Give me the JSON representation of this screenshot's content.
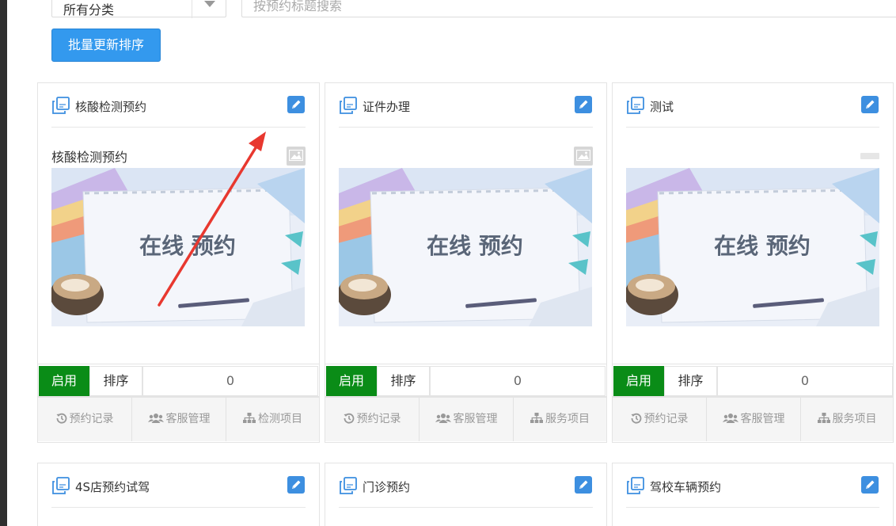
{
  "filters": {
    "category_value": "所有分类",
    "search_placeholder": "按预约标题搜索"
  },
  "toolbar": {
    "batch_sort_label": "批量更新排序"
  },
  "banner_text": "在线 预约",
  "labels": {
    "enable": "启用",
    "sort": "排序"
  },
  "cards": [
    {
      "title": "核酸检测预约",
      "subtitle": "核酸检测预约",
      "sort_value": "0",
      "actions": [
        "预约记录",
        "客服管理",
        "检测项目"
      ]
    },
    {
      "title": "证件办理",
      "subtitle": "",
      "sort_value": "0",
      "actions": [
        "预约记录",
        "客服管理",
        "服务项目"
      ]
    },
    {
      "title": "测试",
      "subtitle": "",
      "sort_value": "0",
      "actions": [
        "预约记录",
        "客服管理",
        "服务项目"
      ]
    },
    {
      "title": "4S店预约试驾"
    },
    {
      "title": "门诊预约"
    },
    {
      "title": "驾校车辆预约"
    }
  ],
  "icons": {
    "card_title": "copy-icon",
    "edit": "pencil-icon",
    "image": "image-icon",
    "actions": [
      "history-icon",
      "users-icon",
      "sitemap-icon"
    ]
  },
  "colors": {
    "primary": "#3399ee",
    "enable": "#0a8c17",
    "annotation_arrow": "#e8382f"
  }
}
